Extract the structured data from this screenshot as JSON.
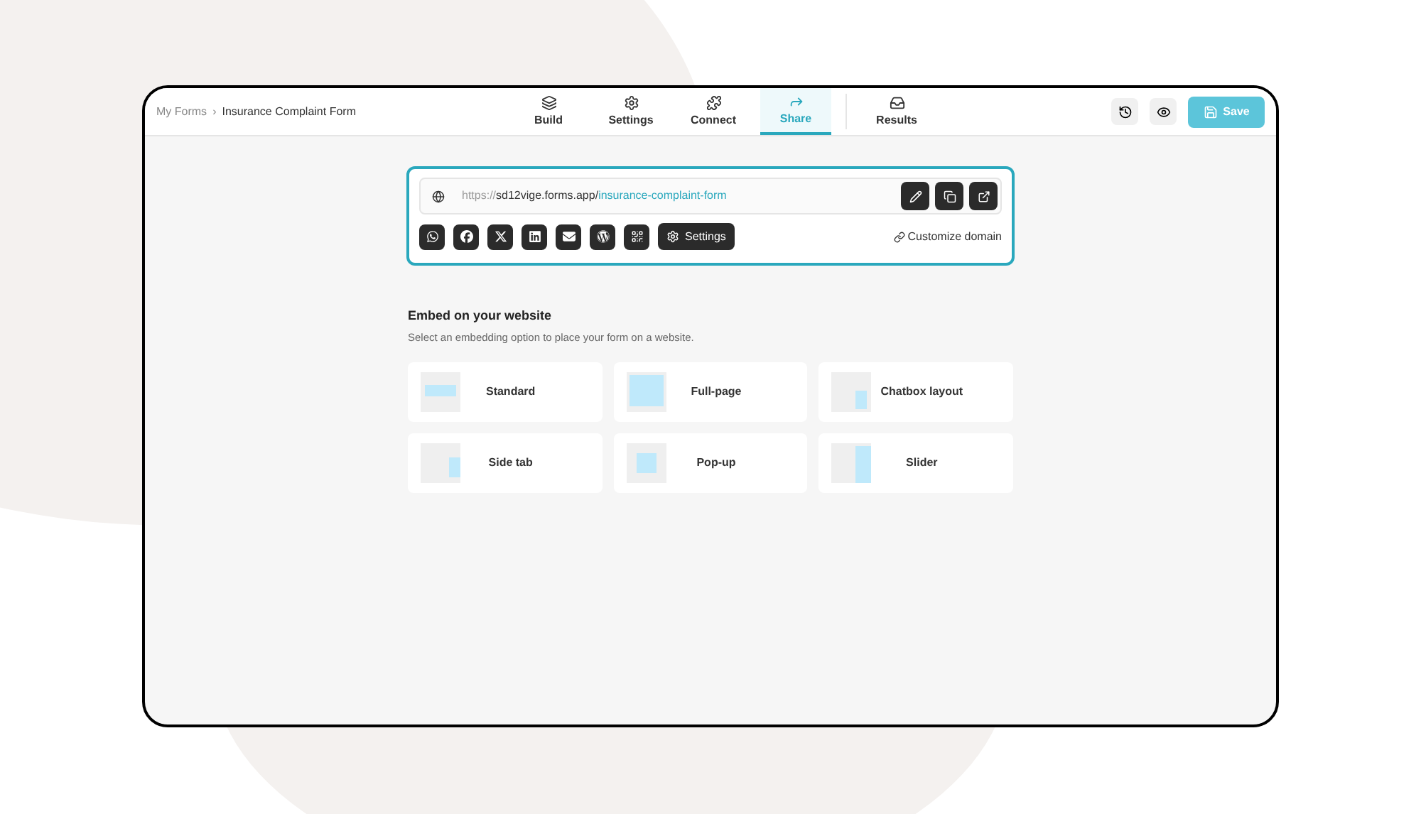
{
  "breadcrumb": {
    "parent": "My Forms",
    "separator": "›",
    "current": "Insurance Complaint Form"
  },
  "tabs": [
    {
      "label": "Build",
      "selected": false
    },
    {
      "label": "Settings",
      "selected": false
    },
    {
      "label": "Connect",
      "selected": false
    },
    {
      "label": "Share",
      "selected": true
    },
    {
      "label": "Results",
      "selected": false
    }
  ],
  "save_button": "Save",
  "share_link": {
    "protocol": "https://",
    "domain": "sd12vige.forms.app/",
    "slug": "insurance-complaint-form"
  },
  "share_buttons": [
    {
      "kind": "whatsapp"
    },
    {
      "kind": "facebook"
    },
    {
      "kind": "x"
    },
    {
      "kind": "linkedin"
    },
    {
      "kind": "email"
    },
    {
      "kind": "wordpress"
    },
    {
      "kind": "qr"
    }
  ],
  "settings_button": "Settings",
  "customize_domain": "Customize domain",
  "embed": {
    "title": "Embed on your website",
    "subtitle": "Select an embedding option to place your form on a website.",
    "options": [
      {
        "label": "Standard",
        "kind": "standard"
      },
      {
        "label": "Full-page",
        "kind": "fullpage"
      },
      {
        "label": "Chatbox layout",
        "kind": "chatbox"
      },
      {
        "label": "Side tab",
        "kind": "sidetab"
      },
      {
        "label": "Pop-up",
        "kind": "popup"
      },
      {
        "label": "Slider",
        "kind": "slider"
      }
    ]
  }
}
